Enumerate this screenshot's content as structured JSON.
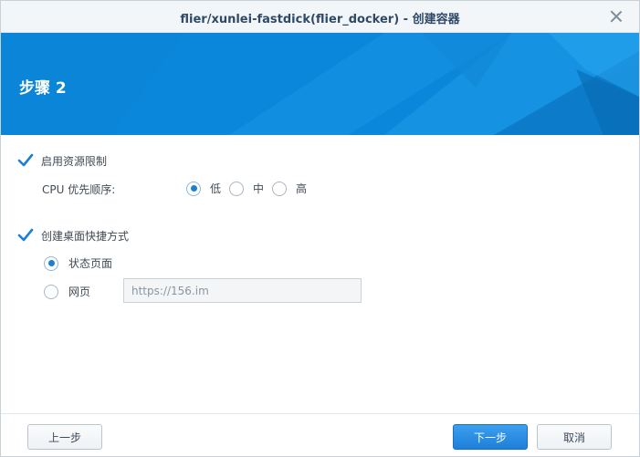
{
  "window": {
    "title": "flier/xunlei-fastdick(flier_docker) - 创建容器"
  },
  "banner": {
    "step_title": "步骤 2"
  },
  "resource_limit": {
    "checkbox_label": "启用资源限制",
    "checked": true,
    "cpu_priority_label": "CPU 优先顺序:",
    "options": [
      "低",
      "中",
      "高"
    ],
    "selected": "低"
  },
  "shortcut": {
    "checkbox_label": "创建桌面快捷方式",
    "checked": true,
    "options": {
      "status_page": "状态页面",
      "web_page": "网页"
    },
    "selected": "状态页面",
    "url_value": "https://156.im"
  },
  "footer": {
    "prev_label": "上一步",
    "next_label": "下一步",
    "cancel_label": "取消"
  },
  "colors": {
    "accent": "#1a7fd6",
    "banner": "#0a86da",
    "primary_button": "#1d7fd8"
  },
  "icons": {
    "close": "close-icon",
    "check": "checkmark-icon"
  }
}
